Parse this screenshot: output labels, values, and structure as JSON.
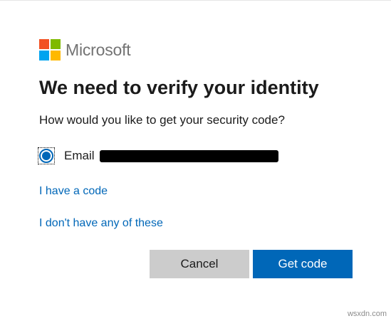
{
  "brand": {
    "name": "Microsoft",
    "logo_colors": [
      "#f25022",
      "#7fba00",
      "#00a4ef",
      "#ffb900"
    ]
  },
  "heading": {
    "title": "We need to verify your identity",
    "subtitle": "How would you like to get your security code?"
  },
  "options": [
    {
      "label": "Email",
      "selected": true
    }
  ],
  "links": {
    "have_code": "I have a code",
    "none_of_these": "I don't have any of these"
  },
  "buttons": {
    "cancel": "Cancel",
    "primary": "Get code"
  },
  "watermark": "wsxdn.com",
  "colors": {
    "accent": "#0067b8",
    "secondary_button": "#cccccc",
    "text": "#1b1b1b"
  }
}
